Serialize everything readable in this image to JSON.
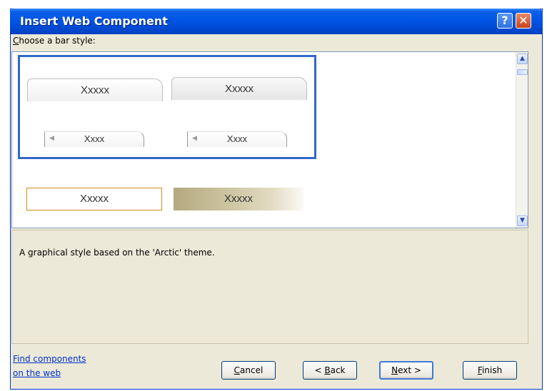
{
  "window": {
    "title": "Insert Web Component",
    "help_glyph": "?",
    "close_glyph": "✕"
  },
  "chooser": {
    "label_mnemonic": "C",
    "label_rest": "hoose a bar style:",
    "styles": {
      "arctic_tab_1": "Xxxxx",
      "arctic_tab_2": "Xxxxx",
      "arctic_small_1": "Xxxx",
      "arctic_small_2": "Xxxx",
      "orange_tab": "Xxxxx",
      "textured_tab": "Xxxxx"
    },
    "selected_style": "Arctic"
  },
  "scrollbar": {
    "up_glyph": "▲",
    "down_glyph": "▼"
  },
  "description": "A graphical style based on the 'Arctic' theme.",
  "footer": {
    "link_line1": "Find components",
    "link_line2": "on the web",
    "buttons": {
      "cancel": {
        "mnemonic": "C",
        "rest": "ancel"
      },
      "back": {
        "prefix": "< ",
        "mnemonic": "B",
        "rest": "ack"
      },
      "next": {
        "mnemonic": "N",
        "rest": "ext >"
      },
      "finish": {
        "mnemonic": "F",
        "rest": "inish"
      }
    }
  },
  "colors": {
    "titlebar": "#0055e5",
    "selection_border": "#3068c8",
    "orange_border": "#d08c1a",
    "link": "#0033cc"
  }
}
